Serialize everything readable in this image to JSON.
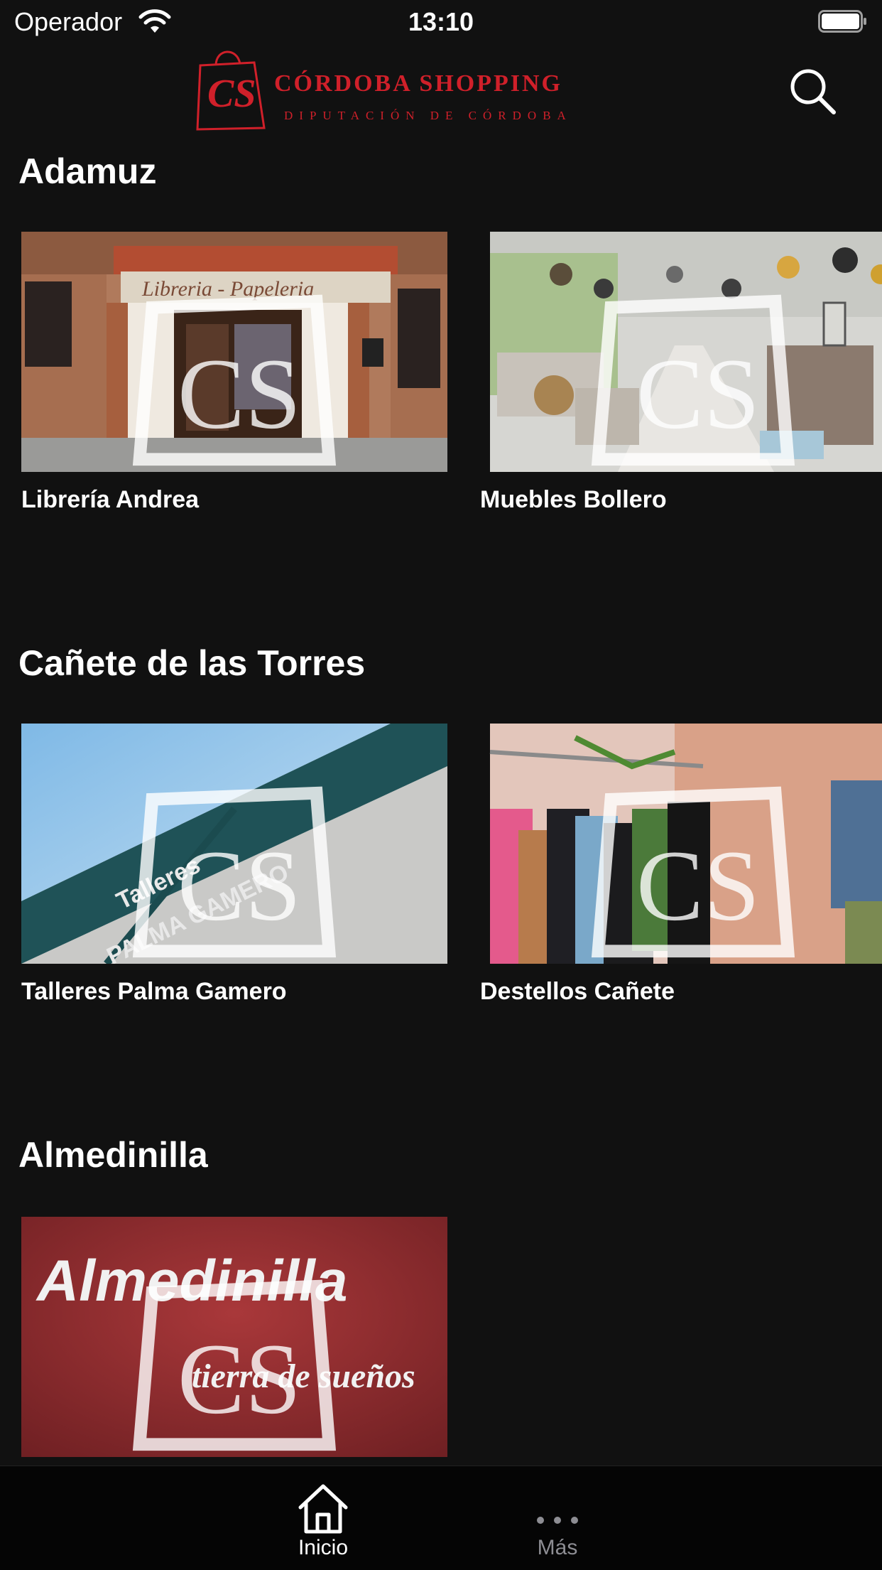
{
  "status_bar": {
    "carrier": "Operador",
    "time": "13:10"
  },
  "header": {
    "logo": {
      "title": "CÓRDOBA SHOPPING",
      "subtitle": "DIPUTACIÓN DE CÓRDOBA",
      "mark": "CS",
      "color": "#d0202a"
    },
    "search_icon": "search-icon"
  },
  "sections": [
    {
      "title": "Adamuz",
      "shops": [
        {
          "name": "Librería Andrea"
        },
        {
          "name": "Muebles Bollero"
        }
      ]
    },
    {
      "title": "Cañete de las Torres",
      "shops": [
        {
          "name": "Talleres Palma Gamero"
        },
        {
          "name": "Destellos Cañete"
        }
      ]
    },
    {
      "title": "Almedinilla",
      "shops": [
        {
          "name": ""
        }
      ]
    }
  ],
  "images": {
    "libreria": {
      "sign": "Libreria - Papeleria"
    },
    "talleres": {
      "sign_line1": "Talleres",
      "sign_line2": "PALMA GAMERO"
    },
    "almedinilla": {
      "title": "Almedinilla",
      "subtitle": "tierra de sueños"
    }
  },
  "tab_bar": {
    "tabs": [
      {
        "label": "Inicio",
        "icon": "home-icon",
        "active": true
      },
      {
        "label": "Más",
        "icon": "more-icon",
        "active": false
      }
    ]
  },
  "colors": {
    "background": "#111111",
    "accent": "#d0202a",
    "tab_inactive": "#8d8d93"
  }
}
